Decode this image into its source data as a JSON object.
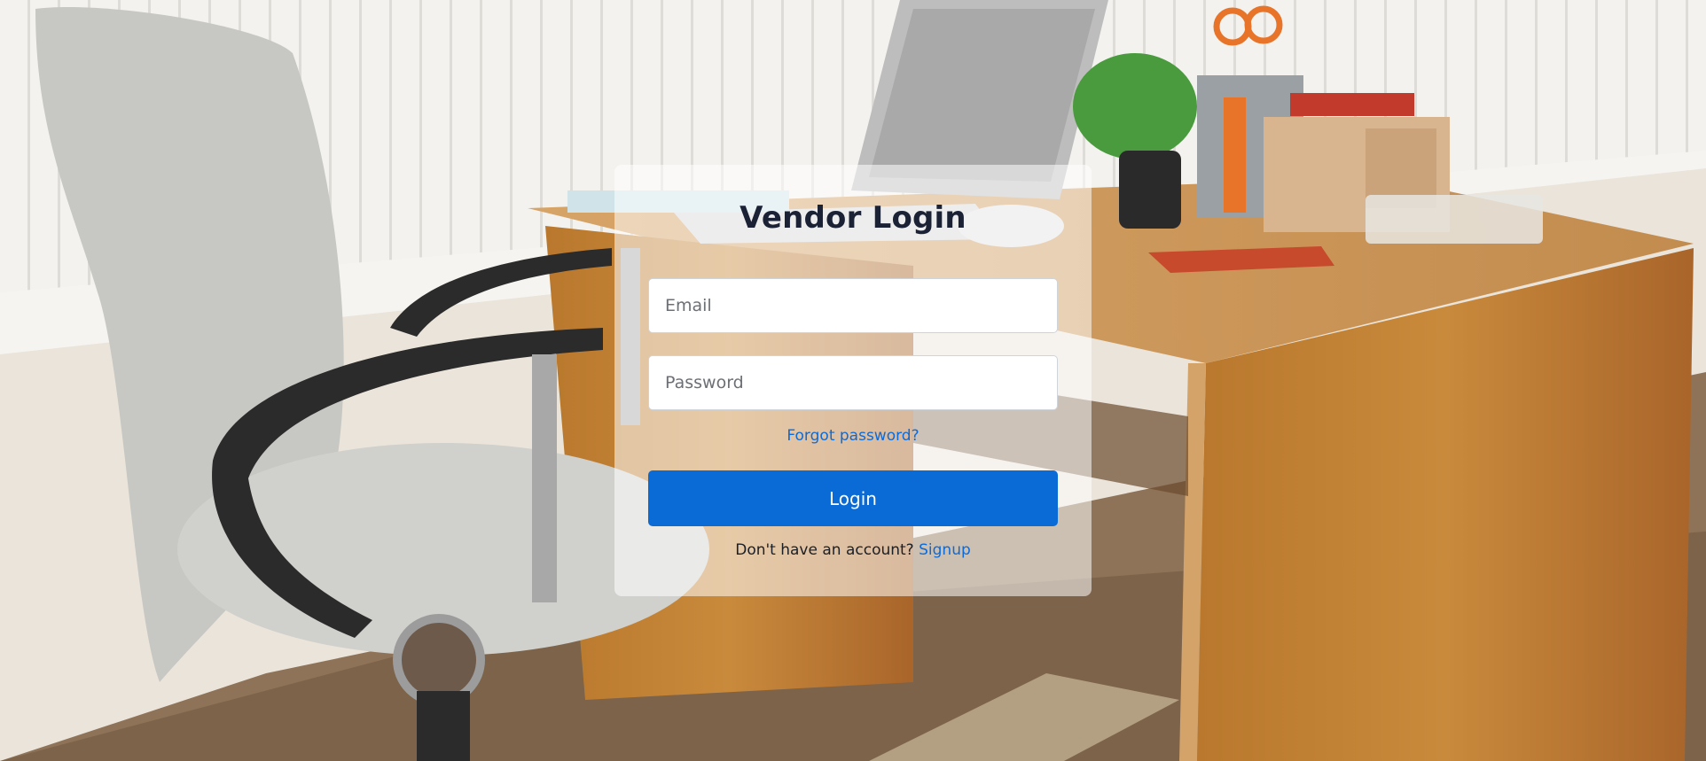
{
  "login": {
    "title": "Vendor Login",
    "email_placeholder": "Email",
    "password_placeholder": "Password",
    "forgot_label": "Forgot password?",
    "login_label": "Login",
    "signup_prompt": "Don't have an account?",
    "signup_label": "Signup"
  },
  "colors": {
    "accent": "#0b6bd6",
    "link": "#0d6ad6",
    "title": "#1b2235"
  }
}
